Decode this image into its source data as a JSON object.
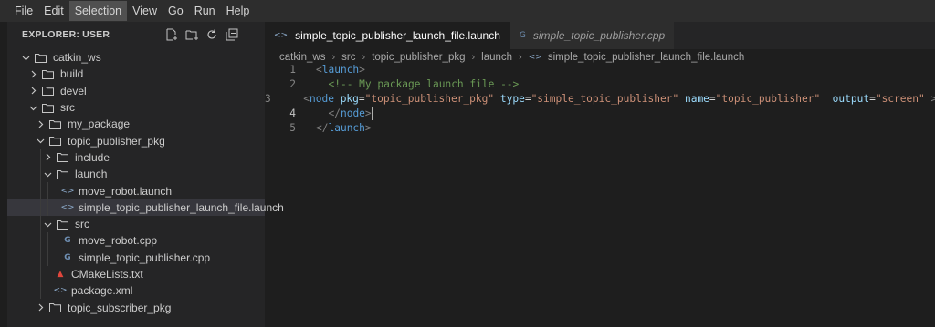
{
  "menu": [
    "File",
    "Edit",
    "Selection",
    "View",
    "Go",
    "Run",
    "Help"
  ],
  "menu_active": "Selection",
  "explorer": {
    "title": "EXPLORER: USER",
    "actions": [
      "new-file-icon",
      "new-folder-icon",
      "refresh-icon",
      "collapse-all-icon"
    ],
    "tree": [
      {
        "label": "catkin_ws",
        "type": "folder",
        "depth": 0,
        "open": true
      },
      {
        "label": "build",
        "type": "folder",
        "depth": 1,
        "open": false
      },
      {
        "label": "devel",
        "type": "folder",
        "depth": 1,
        "open": false
      },
      {
        "label": "src",
        "type": "folder",
        "depth": 1,
        "open": true
      },
      {
        "label": "my_package",
        "type": "folder",
        "depth": 2,
        "open": false
      },
      {
        "label": "topic_publisher_pkg",
        "type": "folder",
        "depth": 2,
        "open": true
      },
      {
        "label": "include",
        "type": "folder",
        "depth": 3,
        "open": false
      },
      {
        "label": "launch",
        "type": "folder",
        "depth": 3,
        "open": true
      },
      {
        "label": "move_robot.launch",
        "type": "xml",
        "depth": 4
      },
      {
        "label": "simple_topic_publisher_launch_file.launch",
        "type": "xml",
        "depth": 4,
        "selected": true
      },
      {
        "label": "src",
        "type": "folder",
        "depth": 3,
        "open": true
      },
      {
        "label": "move_robot.cpp",
        "type": "cpp",
        "depth": 4
      },
      {
        "label": "simple_topic_publisher.cpp",
        "type": "cpp",
        "depth": 4
      },
      {
        "label": "CMakeLists.txt",
        "type": "cmake",
        "depth": 3
      },
      {
        "label": "package.xml",
        "type": "xml",
        "depth": 3
      },
      {
        "label": "topic_subscriber_pkg",
        "type": "folder",
        "depth": 2,
        "open": false
      }
    ]
  },
  "tabs": [
    {
      "label": "simple_topic_publisher_launch_file.launch",
      "icon": "xml-icon",
      "active": true
    },
    {
      "label": "simple_topic_publisher.cpp",
      "icon": "cpp-icon",
      "active": false
    }
  ],
  "breadcrumb": [
    "catkin_ws",
    "src",
    "topic_publisher_pkg",
    "launch",
    "simple_topic_publisher_launch_file.launch"
  ],
  "code": {
    "current_line": 4,
    "lines": [
      {
        "n": "1",
        "indent": "",
        "tokens": [
          [
            "tag",
            "<"
          ],
          [
            "tname",
            "launch"
          ],
          [
            "tag",
            ">"
          ]
        ]
      },
      {
        "n": "2",
        "indent": "  ",
        "tokens": [
          [
            "cmt",
            "<!-- My package launch file -->"
          ]
        ]
      },
      {
        "n": "3",
        "indent": "  ",
        "tokens": [
          [
            "tag",
            "<"
          ],
          [
            "tname",
            "node"
          ],
          [
            "eq",
            " "
          ],
          [
            "attr",
            "pkg"
          ],
          [
            "eq",
            "="
          ],
          [
            "val",
            "\"topic_publisher_pkg\""
          ],
          [
            "eq",
            " "
          ],
          [
            "attr",
            "type"
          ],
          [
            "eq",
            "="
          ],
          [
            "val",
            "\"simple_topic_publisher\""
          ],
          [
            "eq",
            " "
          ],
          [
            "attr",
            "name"
          ],
          [
            "eq",
            "="
          ],
          [
            "val",
            "\"topic_publisher\""
          ],
          [
            "eq",
            "  "
          ],
          [
            "attr",
            "output"
          ],
          [
            "eq",
            "="
          ],
          [
            "val",
            "\"screen\""
          ],
          [
            "eq",
            " "
          ],
          [
            "tag",
            ">"
          ]
        ]
      },
      {
        "n": "4",
        "indent": "  ",
        "tokens": [
          [
            "tag",
            "</"
          ],
          [
            "tname",
            "node"
          ],
          [
            "tag",
            ">"
          ]
        ]
      },
      {
        "n": "5",
        "indent": "",
        "tokens": [
          [
            "tag",
            "</"
          ],
          [
            "tname",
            "launch"
          ],
          [
            "tag",
            ">"
          ]
        ]
      }
    ]
  }
}
